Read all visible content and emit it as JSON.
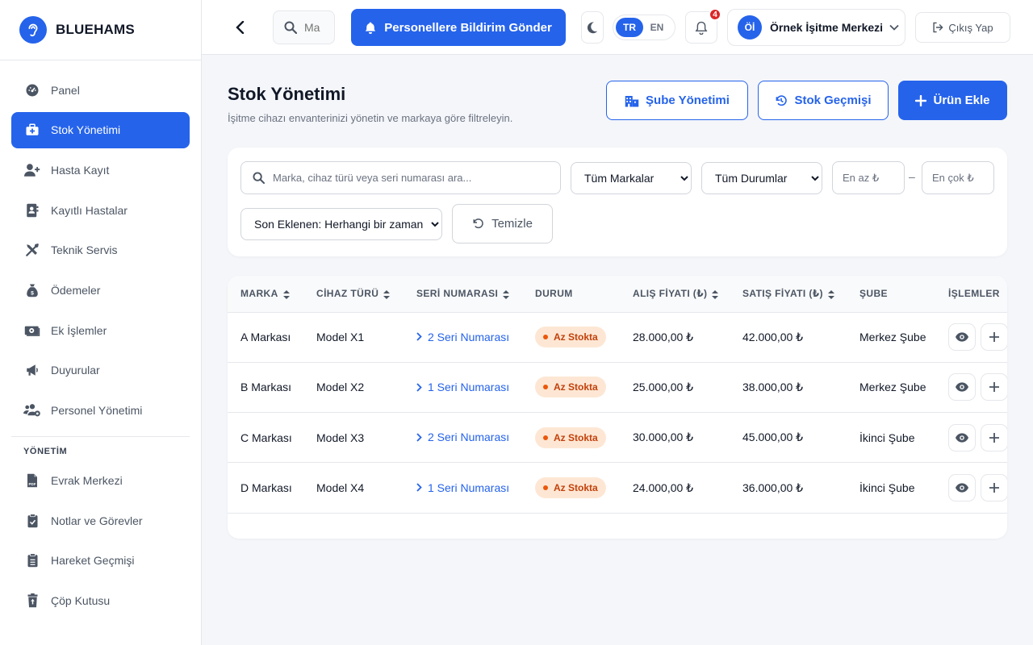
{
  "brand": {
    "name": "BLUEHAMS"
  },
  "sidebar": {
    "items": [
      {
        "label": "Panel",
        "icon": "gauge-icon",
        "active": false
      },
      {
        "label": "Stok Yönetimi",
        "icon": "medkit-icon",
        "active": true
      },
      {
        "label": "Hasta Kayıt",
        "icon": "user-plus-icon",
        "active": false
      },
      {
        "label": "Kayıtlı Hastalar",
        "icon": "address-card-icon",
        "active": false
      },
      {
        "label": "Teknik Servis",
        "icon": "tools-icon",
        "active": false
      },
      {
        "label": "Ödemeler",
        "icon": "money-bag-icon",
        "active": false
      },
      {
        "label": "Ek İşlemler",
        "icon": "money-bill-icon",
        "active": false
      },
      {
        "label": "Duyurular",
        "icon": "bullhorn-icon",
        "active": false
      },
      {
        "label": "Personel Yönetimi",
        "icon": "users-cog-icon",
        "active": false
      }
    ],
    "section_title": "YÖNETİM",
    "admin_items": [
      {
        "label": "Evrak Merkezi",
        "icon": "pdf-file-icon"
      },
      {
        "label": "Notlar ve Görevler",
        "icon": "clipboard-check-icon"
      },
      {
        "label": "Hareket Geçmişi",
        "icon": "clipboard-list-icon"
      },
      {
        "label": "Çöp Kutusu",
        "icon": "trash-restore-icon"
      }
    ]
  },
  "topbar": {
    "search_placeholder": "Ma",
    "notify_button": "Personellere Bildirim Gönder",
    "lang_tr": "TR",
    "lang_en": "EN",
    "notification_count": "4",
    "user_initials": "Öİ",
    "user_name": "Örnek İşitme Merkezi",
    "logout": "Çıkış Yap"
  },
  "header": {
    "title": "Stok Yönetimi",
    "subtitle": "İşitme cihazı envanterinizi yönetin ve markaya göre filtreleyin.",
    "branch_button": "Şube Yönetimi",
    "history_button": "Stok Geçmişi",
    "add_button": "Ürün Ekle"
  },
  "filters": {
    "search_placeholder": "Marka, cihaz türü veya seri numarası ara...",
    "brand_select": "Tüm Markalar",
    "status_select": "Tüm Durumlar",
    "min_price_placeholder": "En az ₺",
    "max_price_placeholder": "En çok ₺",
    "dash": "–",
    "added_select": "Son Eklenen: Herhangi bir zaman",
    "clear_button": "Temizle"
  },
  "table": {
    "columns": [
      "MARKA",
      "CİHAZ TÜRÜ",
      "SERİ NUMARASI",
      "DURUM",
      "ALIŞ FİYATI (₺)",
      "SATIŞ FİYATI (₺)",
      "ŞUBE",
      "İŞLEMLER"
    ],
    "rows": [
      {
        "brand": "A Markası",
        "device": "Model X1",
        "serial": "2 Seri Numarası",
        "status": "Az Stokta",
        "buy": "28.000,00 ₺",
        "sell": "42.000,00 ₺",
        "branch": "Merkez Şube"
      },
      {
        "brand": "B Markası",
        "device": "Model X2",
        "serial": "1 Seri Numarası",
        "status": "Az Stokta",
        "buy": "25.000,00 ₺",
        "sell": "38.000,00 ₺",
        "branch": "Merkez Şube"
      },
      {
        "brand": "C Markası",
        "device": "Model X3",
        "serial": "2 Seri Numarası",
        "status": "Az Stokta",
        "buy": "30.000,00 ₺",
        "sell": "45.000,00 ₺",
        "branch": "İkinci Şube"
      },
      {
        "brand": "D Markası",
        "device": "Model X4",
        "serial": "1 Seri Numarası",
        "status": "Az Stokta",
        "buy": "24.000,00 ₺",
        "sell": "36.000,00 ₺",
        "branch": "İkinci Şube"
      }
    ]
  },
  "colors": {
    "primary": "#2563eb",
    "status_bg": "#fde7d4",
    "status_text": "#c2410c",
    "badge": "#dc2626"
  }
}
